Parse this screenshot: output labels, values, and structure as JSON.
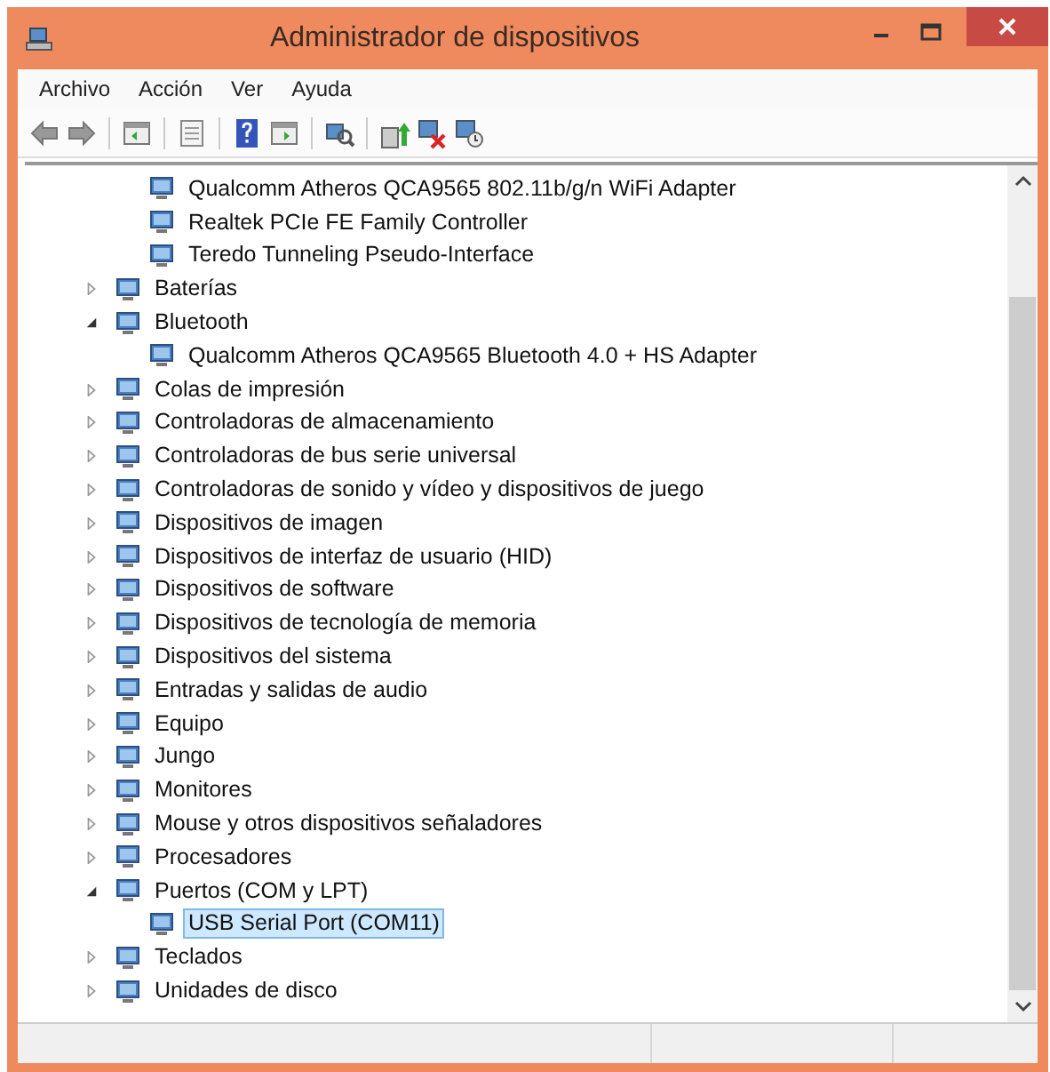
{
  "window": {
    "title": "Administrador de dispositivos"
  },
  "menu": [
    "Archivo",
    "Acción",
    "Ver",
    "Ayuda"
  ],
  "tree": {
    "continued_children": [
      {
        "label": "Qualcomm Atheros QCA9565 802.11b/g/n WiFi Adapter",
        "selected": false
      },
      {
        "label": "Realtek PCIe FE Family Controller",
        "selected": false
      },
      {
        "label": "Teredo Tunneling Pseudo-Interface",
        "selected": false
      }
    ],
    "categories": [
      {
        "label": "Baterías",
        "expanded": false
      },
      {
        "label": "Bluetooth",
        "expanded": true,
        "children": [
          {
            "label": "Qualcomm Atheros QCA9565 Bluetooth 4.0 + HS Adapter",
            "selected": false
          }
        ]
      },
      {
        "label": "Colas de impresión",
        "expanded": false
      },
      {
        "label": "Controladoras de almacenamiento",
        "expanded": false
      },
      {
        "label": "Controladoras de bus serie universal",
        "expanded": false
      },
      {
        "label": "Controladoras de sonido y vídeo y dispositivos de juego",
        "expanded": false
      },
      {
        "label": "Dispositivos de imagen",
        "expanded": false
      },
      {
        "label": "Dispositivos de interfaz de usuario (HID)",
        "expanded": false
      },
      {
        "label": "Dispositivos de software",
        "expanded": false
      },
      {
        "label": "Dispositivos de tecnología de memoria",
        "expanded": false
      },
      {
        "label": "Dispositivos del sistema",
        "expanded": false
      },
      {
        "label": "Entradas y salidas de audio",
        "expanded": false
      },
      {
        "label": "Equipo",
        "expanded": false
      },
      {
        "label": "Jungo",
        "expanded": false
      },
      {
        "label": "Monitores",
        "expanded": false
      },
      {
        "label": "Mouse y otros dispositivos señaladores",
        "expanded": false
      },
      {
        "label": "Procesadores",
        "expanded": false
      },
      {
        "label": "Puertos (COM y LPT)",
        "expanded": true,
        "children": [
          {
            "label": "USB Serial Port (COM11)",
            "selected": true
          }
        ]
      },
      {
        "label": "Teclados",
        "expanded": false
      },
      {
        "label": "Unidades de disco",
        "expanded": false
      }
    ]
  }
}
